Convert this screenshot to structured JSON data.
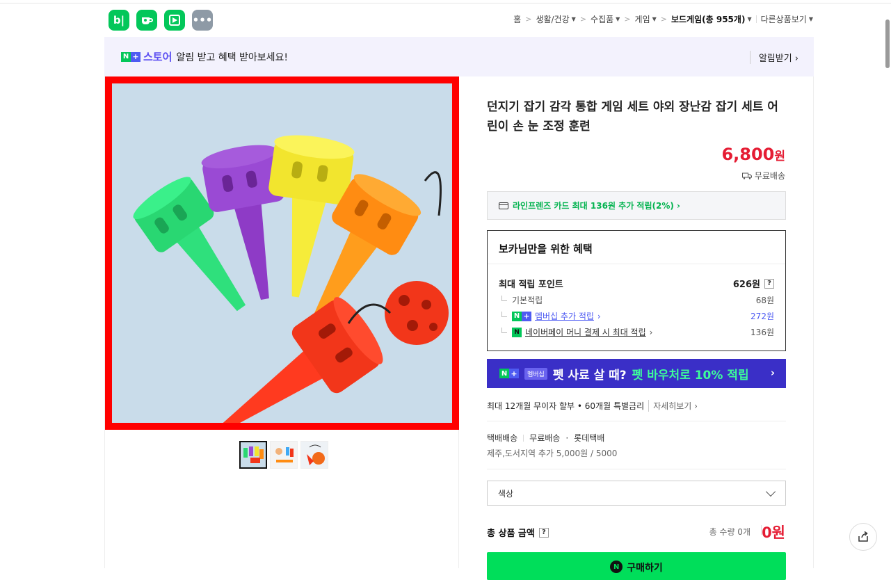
{
  "header": {
    "app_icons": [
      {
        "name": "blog-icon",
        "glyph": "b|",
        "color": "#03c75a"
      },
      {
        "name": "cafe-icon",
        "glyph": "☕",
        "color": "#03c75a"
      },
      {
        "name": "shopping-icon",
        "glyph": "◣",
        "color": "#03c75a"
      },
      {
        "name": "more-apps-icon",
        "glyph": "•••",
        "color": "#8e9aa6"
      }
    ],
    "breadcrumbs": [
      "홈",
      "생활/건강",
      "수집품",
      "게임",
      "보드게임(총 955개)",
      "다른상품보기"
    ]
  },
  "banner": {
    "store_label": "스토어",
    "message": "알림 받고 혜택 받아보세요!",
    "action": "알림받기 ›"
  },
  "product": {
    "title": "던지기 잡기 감각 통합 게임 세트 야외 장난감 잡기 세트 어린이 손 눈 조정 훈련",
    "price": "6,800",
    "price_unit": "원",
    "shipping": "무료배송",
    "card_offer": "라인프렌즈 카드 최대 136원 추가 적립(2%) ›"
  },
  "benefits": {
    "title": "보카님만을 위한 혜택",
    "max_points_label": "최대 적립 포인트",
    "max_points_value": "626원",
    "rows": [
      {
        "label": "기본적립",
        "value": "68원"
      },
      {
        "label": "멤버십 추가 적립",
        "value": "272원"
      },
      {
        "label": "네이버페이 머니 결제 시 최대 적립",
        "value": "136원"
      }
    ],
    "help": "?"
  },
  "pet_banner": {
    "chip": "멤버십",
    "text_white": "펫 사료 살 때?",
    "text_green": "펫 바우처로 10% 적립",
    "arrow": "›"
  },
  "installment": {
    "text": "최대 12개월 무이자 할부 • 60개월 특별금리",
    "more": "자세히보기 ›"
  },
  "delivery": {
    "method": "택배배송",
    "fee": "무료배송",
    "dot": "·",
    "carrier": "롯데택배",
    "extra": "제주,도서지역 추가 5,000원 / 5000"
  },
  "option": {
    "label": "색상"
  },
  "total": {
    "label": "총 상품 금액",
    "help": "?",
    "qty": "총 수량 0개",
    "amount": "0원"
  },
  "buy": {
    "label": "구매하기",
    "pay_glyph": "N"
  },
  "colors": {
    "accent_green": "#03c75a",
    "price_red": "#e51d34",
    "member_blue": "#4e5bf2"
  }
}
